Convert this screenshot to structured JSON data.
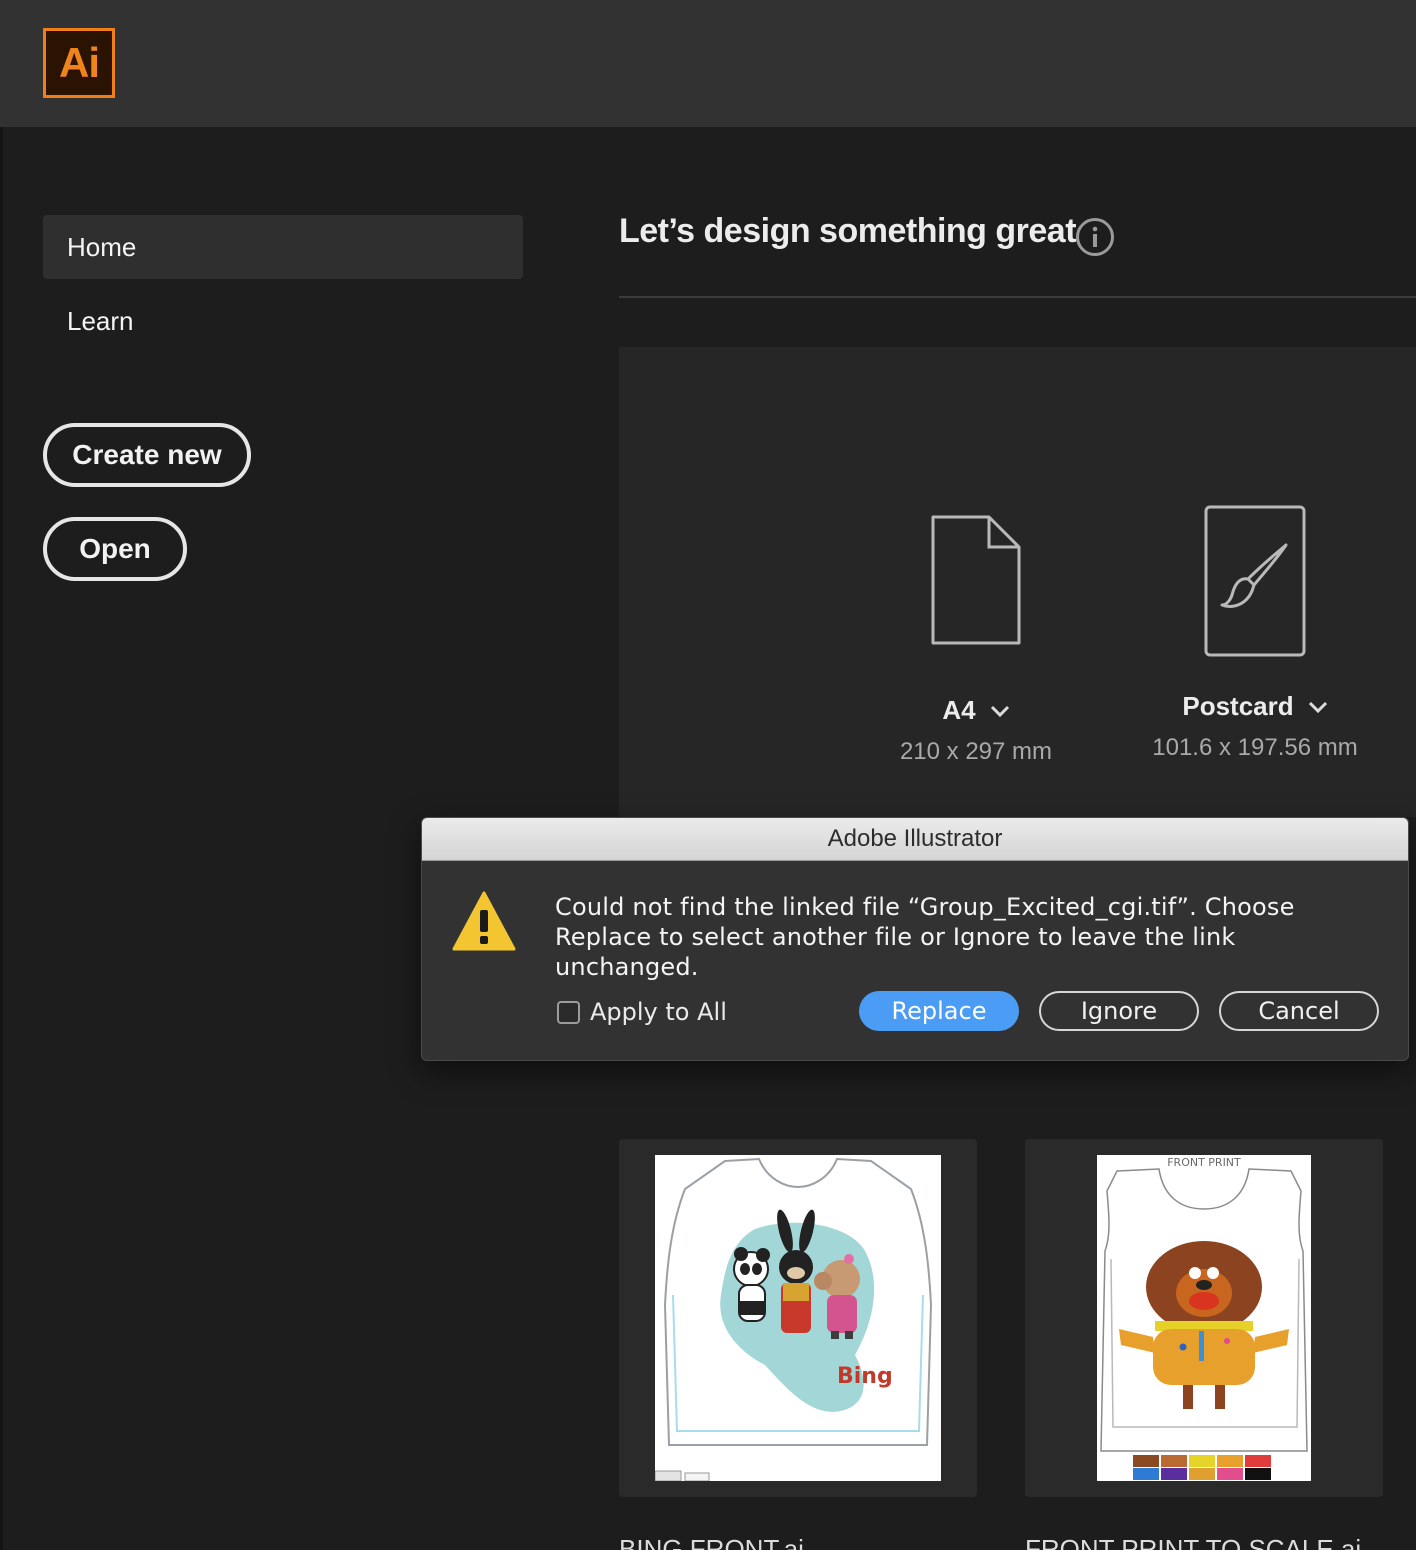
{
  "app": {
    "logo_text": "Ai",
    "accent": "#f07f1a"
  },
  "sidebar": {
    "items": [
      {
        "label": "Home",
        "active": true
      },
      {
        "label": "Learn",
        "active": false
      }
    ],
    "create_label": "Create new",
    "open_label": "Open"
  },
  "main": {
    "headline": "Let’s design something great",
    "presets": [
      {
        "name": "A4",
        "size": "210 x 297 mm",
        "icon": "document-icon"
      },
      {
        "name": "Postcard",
        "size": "101.6 x 197.56 mm",
        "icon": "brush-artboard-icon"
      }
    ],
    "recent_files": [
      {
        "name": "BING FRONT.ai",
        "thumb_label": ""
      },
      {
        "name": "FRONT PRINT TO SCALE.ai",
        "thumb_label": "FRONT PRINT"
      }
    ]
  },
  "dialog": {
    "title": "Adobe Illustrator",
    "message": "Could not find the linked file “Group_Excited_cgi.tif”. Choose Replace to select another file or Ignore to leave the link unchanged.",
    "apply_to_all_label": "Apply to All",
    "apply_to_all_checked": false,
    "replace_label": "Replace",
    "ignore_label": "Ignore",
    "cancel_label": "Cancel",
    "primary_color": "#4a9cf5",
    "warning_color": "#f2c531"
  }
}
